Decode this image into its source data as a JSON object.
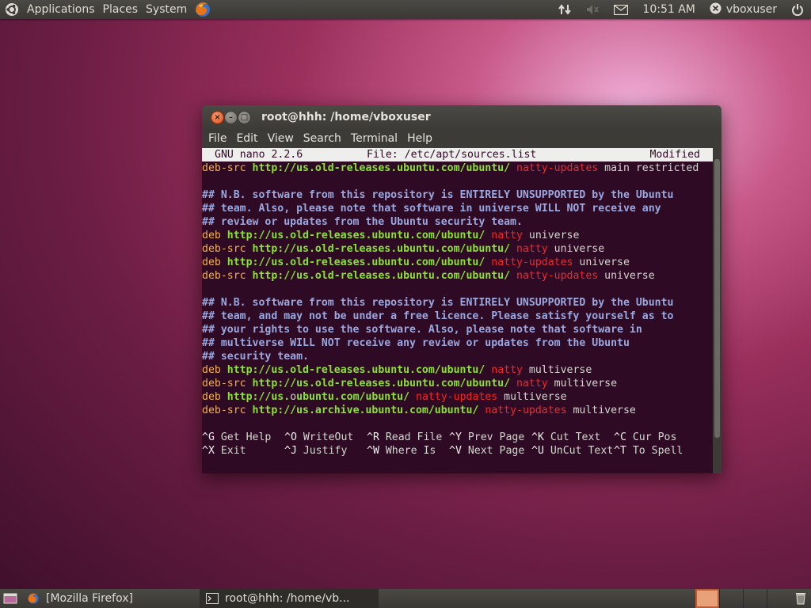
{
  "top_panel": {
    "menus": [
      "Applications",
      "Places",
      "System"
    ],
    "clock": "10:51 AM",
    "user": "vboxuser"
  },
  "window": {
    "title": "root@hhh: /home/vboxuser",
    "menus": [
      "File",
      "Edit",
      "View",
      "Search",
      "Terminal",
      "Help"
    ]
  },
  "nano": {
    "version": "GNU nano 2.2.6",
    "file": "File: /etc/apt/sources.list",
    "status": "Modified",
    "lines": [
      [
        {
          "t": "deb-src",
          "c": "deb"
        },
        {
          "t": " "
        },
        {
          "t": "http://us.old-releases.ubuntu.com/ubuntu/",
          "c": "url"
        },
        {
          "t": " "
        },
        {
          "t": "natty-updates",
          "c": "rel"
        },
        {
          "t": " main restricted",
          "c": "comp"
        }
      ],
      [],
      [
        {
          "t": "## N.B. software from this repository is ENTIRELY UNSUPPORTED by the Ubuntu",
          "c": "cmt"
        }
      ],
      [
        {
          "t": "## team. Also, please note that software in universe WILL NOT receive any",
          "c": "cmt"
        }
      ],
      [
        {
          "t": "## review or updates from the Ubuntu security team.",
          "c": "cmt"
        }
      ],
      [
        {
          "t": "deb",
          "c": "deb"
        },
        {
          "t": " "
        },
        {
          "t": "http://us.old-releases.ubuntu.com/ubuntu/",
          "c": "url"
        },
        {
          "t": " "
        },
        {
          "t": "natty",
          "c": "rel"
        },
        {
          "t": " universe",
          "c": "comp"
        }
      ],
      [
        {
          "t": "deb-src",
          "c": "deb"
        },
        {
          "t": " "
        },
        {
          "t": "http://us.old-releases.ubuntu.com/ubuntu/",
          "c": "url"
        },
        {
          "t": " "
        },
        {
          "t": "natty",
          "c": "rel"
        },
        {
          "t": " universe",
          "c": "comp"
        }
      ],
      [
        {
          "t": "deb",
          "c": "deb"
        },
        {
          "t": " "
        },
        {
          "t": "http://us.old-releases.ubuntu.com/ubuntu/",
          "c": "url"
        },
        {
          "t": " "
        },
        {
          "t": "natty-updates",
          "c": "rel"
        },
        {
          "t": " universe",
          "c": "comp"
        }
      ],
      [
        {
          "t": "deb-src",
          "c": "deb"
        },
        {
          "t": " "
        },
        {
          "t": "http://us.old-releases.ubuntu.com/ubuntu/",
          "c": "url"
        },
        {
          "t": " "
        },
        {
          "t": "natty-updates",
          "c": "rel"
        },
        {
          "t": " universe",
          "c": "comp"
        }
      ],
      [],
      [
        {
          "t": "## N.B. software from this repository is ENTIRELY UNSUPPORTED by the Ubuntu",
          "c": "cmt"
        }
      ],
      [
        {
          "t": "## team, and may not be under a free licence. Please satisfy yourself as to",
          "c": "cmt"
        }
      ],
      [
        {
          "t": "## your rights to use the software. Also, please note that software in",
          "c": "cmt"
        }
      ],
      [
        {
          "t": "## multiverse WILL NOT receive any review or updates from the Ubuntu",
          "c": "cmt"
        }
      ],
      [
        {
          "t": "## security team.",
          "c": "cmt"
        }
      ],
      [
        {
          "t": "deb",
          "c": "deb"
        },
        {
          "t": " "
        },
        {
          "t": "http://us.old-releases.ubuntu.com/ubuntu/",
          "c": "url"
        },
        {
          "t": " "
        },
        {
          "t": "natty",
          "c": "rel"
        },
        {
          "t": " multiverse",
          "c": "comp"
        }
      ],
      [
        {
          "t": "deb-src",
          "c": "deb"
        },
        {
          "t": " "
        },
        {
          "t": "http://us.old-releases.ubuntu.com/ubuntu/",
          "c": "url"
        },
        {
          "t": " "
        },
        {
          "t": "natty",
          "c": "rel"
        },
        {
          "t": " multiverse",
          "c": "comp"
        }
      ],
      [
        {
          "t": "deb",
          "c": "deb"
        },
        {
          "t": " "
        },
        {
          "t": "http://us.",
          "c": "url"
        },
        {
          "t": "o",
          "c": "cursor"
        },
        {
          "t": "ubuntu.com/ubuntu/",
          "c": "url"
        },
        {
          "t": " "
        },
        {
          "t": "natty-updates",
          "c": "rel"
        },
        {
          "t": " multiverse",
          "c": "comp"
        }
      ],
      [
        {
          "t": "deb-src",
          "c": "deb"
        },
        {
          "t": " "
        },
        {
          "t": "http://us.archive.ubuntu.com/ubuntu/",
          "c": "url"
        },
        {
          "t": " "
        },
        {
          "t": "natty-updates",
          "c": "rel"
        },
        {
          "t": " multiverse",
          "c": "comp"
        }
      ],
      []
    ],
    "shortcuts_row1": [
      {
        "key": "^G",
        "label": "Get Help"
      },
      {
        "key": "^O",
        "label": "WriteOut"
      },
      {
        "key": "^R",
        "label": "Read File"
      },
      {
        "key": "^Y",
        "label": "Prev Page"
      },
      {
        "key": "^K",
        "label": "Cut Text"
      },
      {
        "key": "^C",
        "label": "Cur Pos"
      }
    ],
    "shortcuts_row2": [
      {
        "key": "^X",
        "label": "Exit"
      },
      {
        "key": "^J",
        "label": "Justify"
      },
      {
        "key": "^W",
        "label": "Where Is"
      },
      {
        "key": "^V",
        "label": "Next Page"
      },
      {
        "key": "^U",
        "label": "UnCut Text"
      },
      {
        "key": "^T",
        "label": "To Spell"
      }
    ]
  },
  "taskbar": {
    "tasks": [
      "[Mozilla Firefox]",
      "root@hhh: /home/vb..."
    ]
  },
  "colors": {
    "terminal_bg": "#2f0a24",
    "url": "#8ae234",
    "deb_keyword": "#f3b04a",
    "release": "#ef2929",
    "comment": "#9aa8e0"
  }
}
